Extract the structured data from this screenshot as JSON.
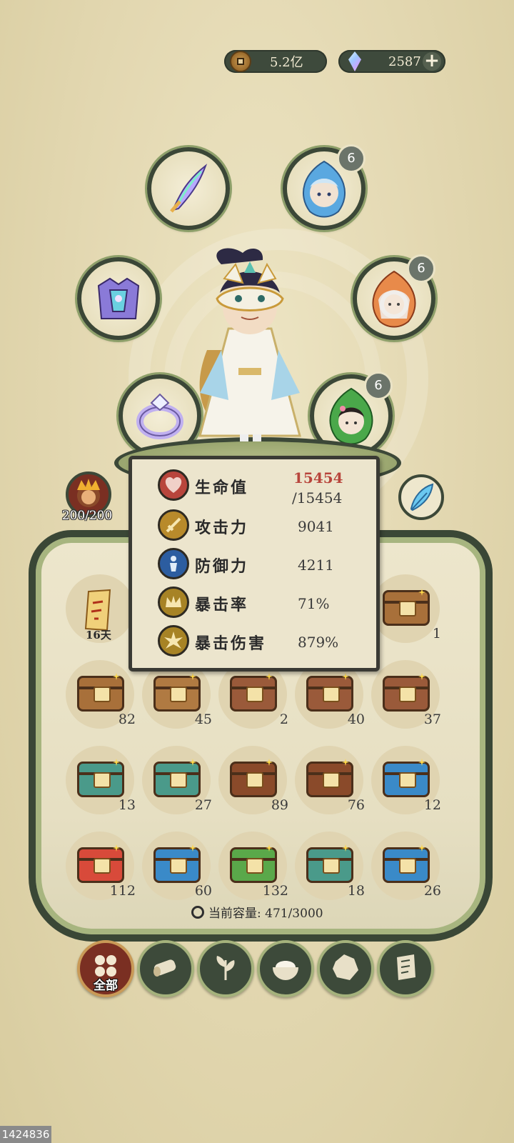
{
  "currency": {
    "coins": "5.2亿",
    "gems": "2587",
    "plus": "+"
  },
  "equipment": {
    "slot_badges": [
      "6",
      "6",
      "6"
    ]
  },
  "side": {
    "hp": "200/200"
  },
  "stats": {
    "rows": [
      {
        "label": "生命值",
        "value": "15454",
        "value2": "/15454",
        "icon": "heart-icon",
        "color": "#b8453c"
      },
      {
        "label": "攻击力",
        "value": "9041",
        "icon": "sword-icon",
        "color": "#b88a2b"
      },
      {
        "label": "防御力",
        "value": "4211",
        "icon": "shield-figure-icon",
        "color": "#2c5da0"
      },
      {
        "label": "暴击率",
        "value": "71%",
        "icon": "crown-icon",
        "color": "#a78325"
      },
      {
        "label": "暴击伤害",
        "value": "879%",
        "icon": "burst-icon",
        "color": "#a78325"
      }
    ]
  },
  "inventory": {
    "scroll_days": "16天",
    "row1_last_count": "1",
    "counts": [
      [
        "82",
        "45",
        "2",
        "40",
        "37"
      ],
      [
        "13",
        "27",
        "89",
        "76",
        "12"
      ],
      [
        "112",
        "60",
        "132",
        "18",
        "26"
      ]
    ],
    "capacity": "当前容量: 471/3000"
  },
  "tabs": {
    "all_label": "全部",
    "icons": [
      "grid-icon",
      "wood-log-icon",
      "herb-icon",
      "rice-bowl-icon",
      "ore-icon",
      "scroll-icon"
    ]
  },
  "watermark": "1424836",
  "colors": {
    "panel_border": "#3a4736",
    "accent_red": "#b8453c",
    "active_tab": "#7a2f22"
  }
}
